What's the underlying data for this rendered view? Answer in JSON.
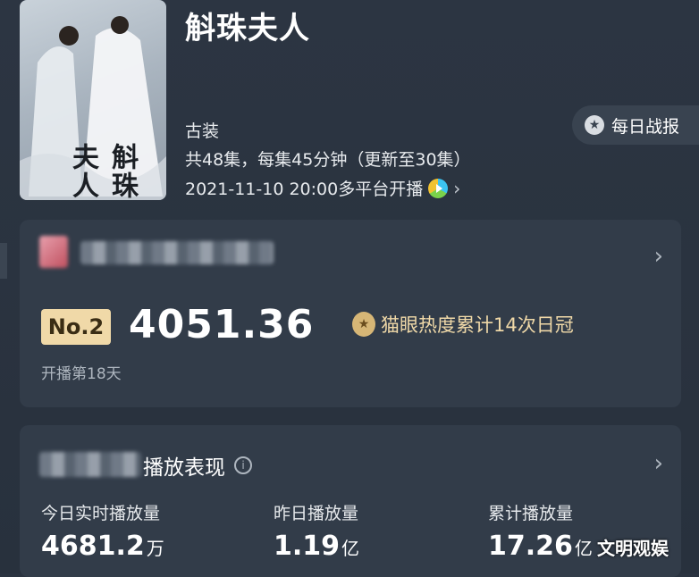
{
  "show": {
    "title": "斛珠夫人",
    "poster_title": "斛珠夫人",
    "genre": "古装",
    "episodes": "共48集，每集45分钟（更新至30集）",
    "premiere": "2021-11-10 20:00多平台开播",
    "premiere_chevron": "›"
  },
  "daily_report": {
    "label": "每日战报",
    "icon": "star-icon"
  },
  "heat": {
    "rank": "No.2",
    "value": "4051.36",
    "crown_text": "猫眼热度累计14次日冠",
    "days_text": "开播第18天",
    "chevron": "›"
  },
  "performance": {
    "title": "播放表现",
    "chevron": "›",
    "info_icon": "i",
    "stats": [
      {
        "label": "今日实时播放量",
        "value": "4681.2",
        "unit": "万"
      },
      {
        "label": "昨日播放量",
        "value": "1.19",
        "unit": "亿"
      },
      {
        "label": "累计播放量",
        "value": "17.26",
        "unit": "亿"
      }
    ]
  },
  "watermark": "文明观娱",
  "colors": {
    "background": "#2a3340",
    "card": "#323c49",
    "rank_badge": "#f0d9a8",
    "gold_text": "#f0d9a8"
  }
}
